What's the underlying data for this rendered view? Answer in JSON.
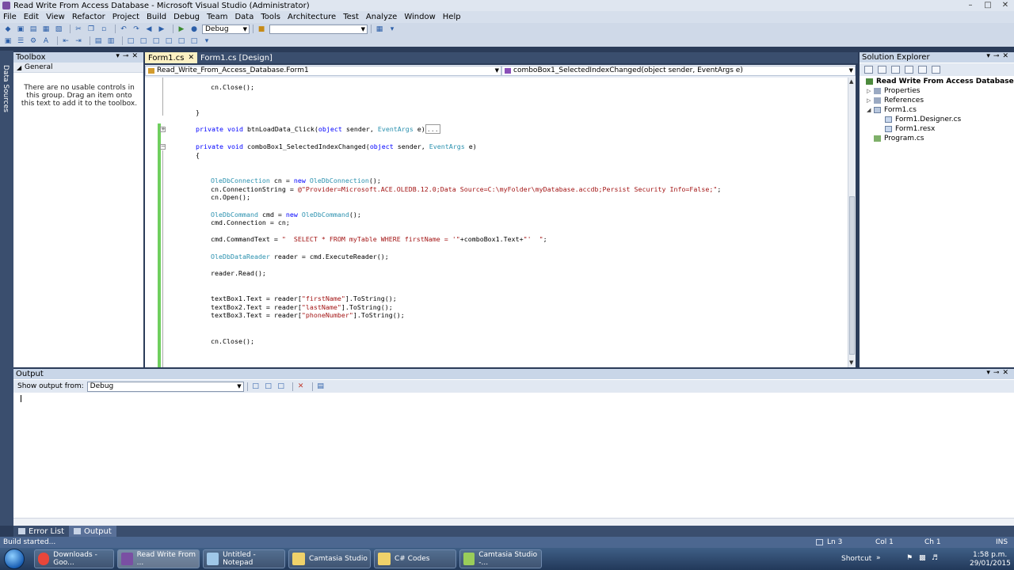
{
  "window": {
    "title": "Read Write From Access Database - Microsoft Visual Studio (Administrator)"
  },
  "menu": [
    "File",
    "Edit",
    "View",
    "Refactor",
    "Project",
    "Build",
    "Debug",
    "Team",
    "Data",
    "Tools",
    "Architecture",
    "Test",
    "Analyze",
    "Window",
    "Help"
  ],
  "toolbar": {
    "config": "Debug",
    "find_value": ""
  },
  "left_strip": {
    "label": "Data Sources"
  },
  "toolbox": {
    "title": "Toolbox",
    "group": "General",
    "message": "There are no usable controls in this group. Drag an item onto this text to add it to the toolbox."
  },
  "editor": {
    "tabs": [
      {
        "label": "Form1.cs",
        "active": true
      },
      {
        "label": "Form1.cs [Design]",
        "active": false
      }
    ],
    "nav_left": "Read_Write_From_Access_Database.Form1",
    "nav_right": "comboBox1_SelectedIndexChanged(object sender, EventArgs e)",
    "lines": [
      [
        [
          "",
          "cn.Close();"
        ]
      ],
      [
        [
          "",
          "}"
        ]
      ],
      [
        [
          "kw",
          "private"
        ],
        [
          "",
          " "
        ],
        [
          "kw",
          "void"
        ],
        [
          "",
          " btnLoadData_Click("
        ],
        [
          "kw",
          "object"
        ],
        [
          "",
          " sender, "
        ],
        [
          "ty",
          "EventArgs"
        ],
        [
          "",
          " e)"
        ],
        [
          "collapsed",
          "..."
        ]
      ],
      [
        [
          "kw",
          "private"
        ],
        [
          "",
          " "
        ],
        [
          "kw",
          "void"
        ],
        [
          "",
          " comboBox1_SelectedIndexChanged("
        ],
        [
          "kw",
          "object"
        ],
        [
          "",
          " sender, "
        ],
        [
          "ty",
          "EventArgs"
        ],
        [
          "",
          " e)"
        ]
      ],
      [
        [
          "",
          "{"
        ]
      ],
      [
        [
          "ty",
          "OleDbConnection"
        ],
        [
          "",
          " cn = "
        ],
        [
          "kw",
          "new"
        ],
        [
          "",
          " "
        ],
        [
          "ty",
          "OleDbConnection"
        ],
        [
          "",
          "();"
        ]
      ],
      [
        [
          "",
          "cn.ConnectionString = "
        ],
        [
          "st",
          "@\"Provider=Microsoft.ACE.OLEDB.12.0;Data Source=C:\\myFolder\\myDatabase.accdb;Persist Security Info=False;\""
        ],
        [
          "",
          ";"
        ]
      ],
      [
        [
          "",
          "cn.Open();"
        ]
      ],
      [
        [
          "ty",
          "OleDbCommand"
        ],
        [
          "",
          " cmd = "
        ],
        [
          "kw",
          "new"
        ],
        [
          "",
          " "
        ],
        [
          "ty",
          "OleDbCommand"
        ],
        [
          "",
          "();"
        ]
      ],
      [
        [
          "",
          "cmd.Connection = cn;"
        ]
      ],
      [
        [
          "",
          "cmd.CommandText = "
        ],
        [
          "st",
          "\"  SELECT * FROM myTable WHERE firstName = '\""
        ],
        [
          "",
          "+comboBox1.Text+"
        ],
        [
          "st",
          "\"'  \""
        ],
        [
          "",
          ";"
        ]
      ],
      [
        [
          "ty",
          "OleDbDataReader"
        ],
        [
          "",
          " reader = cmd.ExecuteReader();"
        ]
      ],
      [
        [
          "",
          "reader.Read();"
        ]
      ],
      [
        [
          "",
          "textBox1.Text = reader["
        ],
        [
          "st",
          "\"firstName\""
        ],
        [
          "",
          "].ToString();"
        ]
      ],
      [
        [
          "",
          "textBox2.Text = reader["
        ],
        [
          "st",
          "\"lastName\""
        ],
        [
          "",
          "].ToString();"
        ]
      ],
      [
        [
          "",
          "textBox3.Text = reader["
        ],
        [
          "st",
          "\"phoneNumber\""
        ],
        [
          "",
          "].ToString();"
        ]
      ],
      [
        [
          "",
          "cn.Close();"
        ]
      ]
    ]
  },
  "solution_explorer": {
    "title": "Solution Explorer",
    "items": [
      {
        "label": "Read Write From Access Database",
        "bold": true
      },
      {
        "label": "Properties"
      },
      {
        "label": "References"
      },
      {
        "label": "Form1.cs"
      },
      {
        "label": "Form1.Designer.cs"
      },
      {
        "label": "Form1.resx"
      },
      {
        "label": "Program.cs"
      }
    ]
  },
  "output": {
    "title": "Output",
    "show_label": "Show output from:",
    "source": "Debug"
  },
  "bottom_tabs": [
    "Error List",
    "Output"
  ],
  "status": {
    "message": "Build started...",
    "ln": "Ln 3",
    "col": "Col 1",
    "ch": "Ch 1",
    "mode": "INS"
  },
  "taskbar": {
    "items": [
      {
        "label": "Downloads - Goo...",
        "color": "#e8463a"
      },
      {
        "label": "Read Write From ...",
        "color": "#7a4fa3",
        "active": true
      },
      {
        "label": "Untitled - Notepad",
        "color": "#9fc7e8"
      },
      {
        "label": "Camtasia Studio",
        "color": "#f0d26a"
      },
      {
        "label": "C# Codes",
        "color": "#f0d26a"
      },
      {
        "label": "Camtasia Studio -...",
        "color": "#9acd5a"
      }
    ],
    "shortcut": "Shortcut",
    "time": "1:58 p.m.",
    "date": "29/01/2015"
  }
}
